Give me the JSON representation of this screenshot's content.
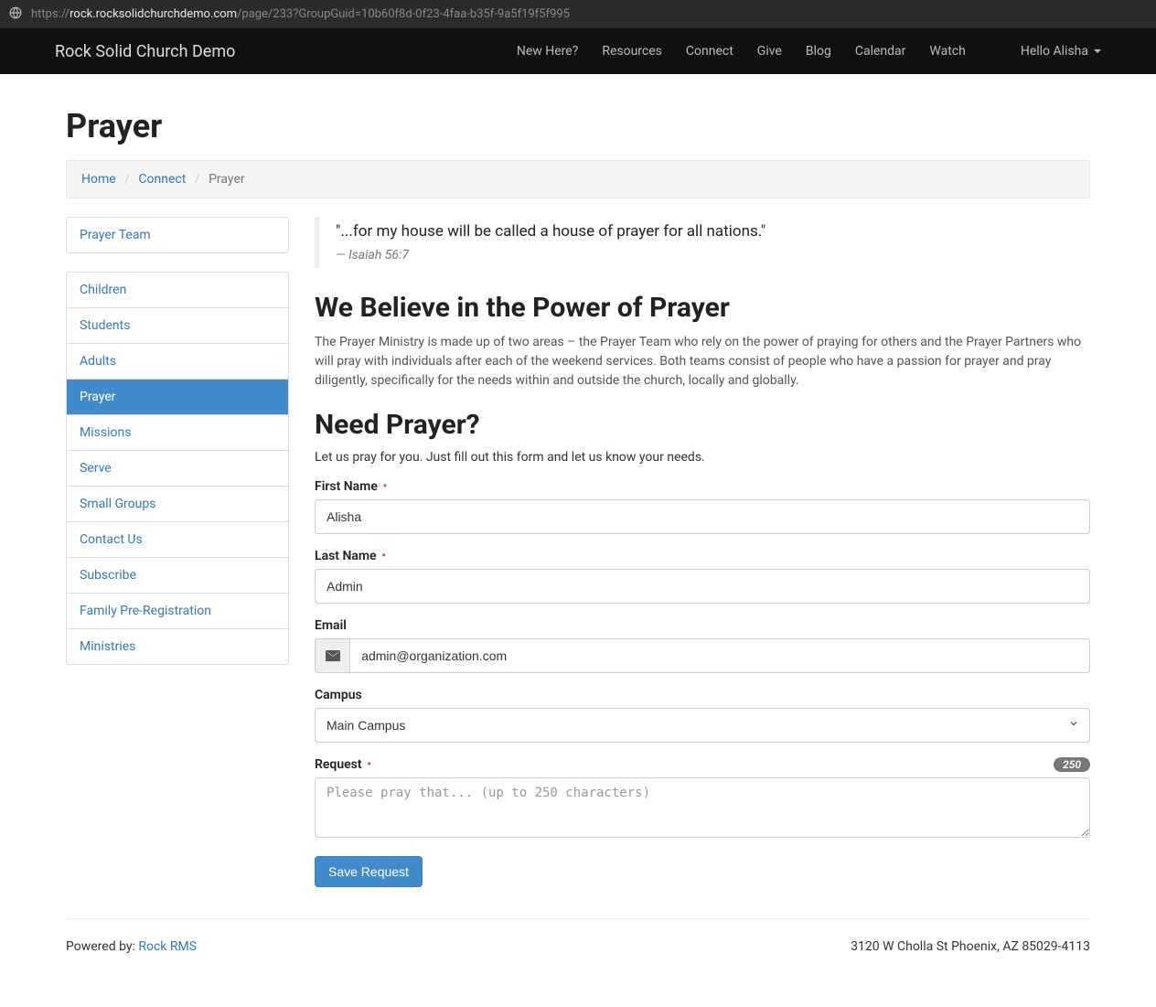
{
  "browser": {
    "url_prefix": "https://",
    "url_host": "rock.rocksolidchurchdemo.com",
    "url_path": "/page/233?GroupGuid=10b60f8d-0f23-4faa-b35f-9a5f19f5f995"
  },
  "topnav": {
    "brand": "Rock Solid Church Demo",
    "links": [
      "New Here?",
      "Resources",
      "Connect",
      "Give",
      "Blog",
      "Calendar",
      "Watch"
    ],
    "greeting": "Hello Alisha"
  },
  "page": {
    "title": "Prayer"
  },
  "breadcrumb": {
    "home": "Home",
    "connect": "Connect",
    "current": "Prayer"
  },
  "sidebar_top": {
    "items": [
      "Prayer Team"
    ]
  },
  "sidebar": {
    "items": [
      "Children",
      "Students",
      "Adults",
      "Prayer",
      "Missions",
      "Serve",
      "Small Groups",
      "Contact Us",
      "Subscribe",
      "Family Pre-Registration",
      "Ministries"
    ],
    "active_index": 3
  },
  "quote": {
    "text": "\"...for my house will be called a house of prayer for all nations.\"",
    "cite": "— Isaiah 56:7"
  },
  "section1": {
    "heading": "We Believe in the Power of Prayer",
    "body": "The Prayer Ministry is made up of two areas – the Prayer Team who rely on the power of praying for others and the Prayer Partners who will pray with individuals after each of the weekend services. Both teams consist of people who have a passion for prayer and pray diligently, specifically for the needs within and outside the church, locally and globally."
  },
  "section2": {
    "heading": "Need Prayer?",
    "sub": "Let us pray for you. Just fill out this form and let us know your needs."
  },
  "form": {
    "first_name_label": "First Name",
    "first_name_value": "Alisha",
    "last_name_label": "Last Name",
    "last_name_value": "Admin",
    "email_label": "Email",
    "email_value": "admin@organization.com",
    "campus_label": "Campus",
    "campus_value": "Main Campus",
    "request_label": "Request",
    "request_placeholder": "Please pray that... (up to 250 characters)",
    "request_counter": "250",
    "submit_label": "Save Request"
  },
  "footer": {
    "powered_prefix": "Powered by: ",
    "powered_link": "Rock RMS",
    "address": "3120 W Cholla St Phoenix, AZ 85029-4113"
  }
}
